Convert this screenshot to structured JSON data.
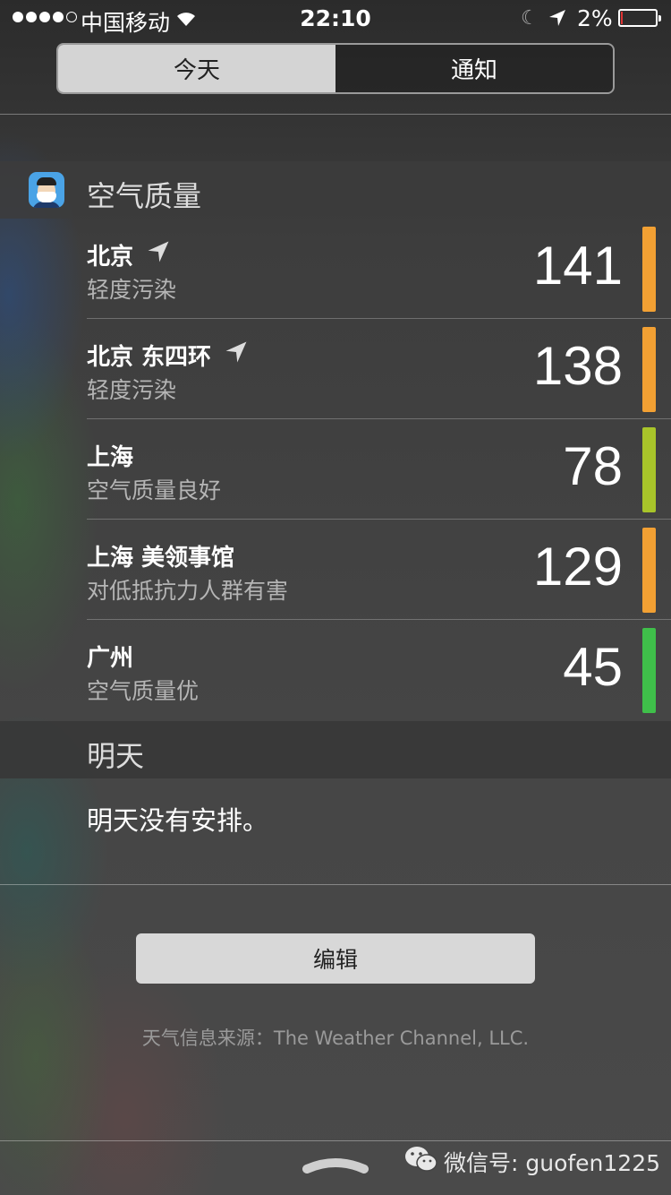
{
  "status_bar": {
    "carrier": "中国移动",
    "time": "22:10",
    "battery_percent": "2%"
  },
  "tabs": [
    {
      "label": "今天",
      "active": true
    },
    {
      "label": "通知",
      "active": false
    }
  ],
  "widget": {
    "title": "空气质量",
    "rows": [
      {
        "city": "北京",
        "status": "轻度污染",
        "aqi": "141",
        "color": "#f2a033",
        "location": true
      },
      {
        "city": "北京 东四环",
        "status": "轻度污染",
        "aqi": "138",
        "color": "#f2a033",
        "location": true
      },
      {
        "city": "上海",
        "status": "空气质量良好",
        "aqi": "78",
        "color": "#a8c42a",
        "location": false
      },
      {
        "city": "上海 美领事馆",
        "status": "对低抵抗力人群有害",
        "aqi": "129",
        "color": "#f2a033",
        "location": false
      },
      {
        "city": "广州",
        "status": "空气质量优",
        "aqi": "45",
        "color": "#3fbf4a",
        "location": false
      }
    ]
  },
  "tomorrow": {
    "title": "明天",
    "text": "明天没有安排。"
  },
  "edit_button": "编辑",
  "source_text": "天气信息来源：The Weather Channel, LLC.",
  "watermark": "微信号: guofen1225"
}
